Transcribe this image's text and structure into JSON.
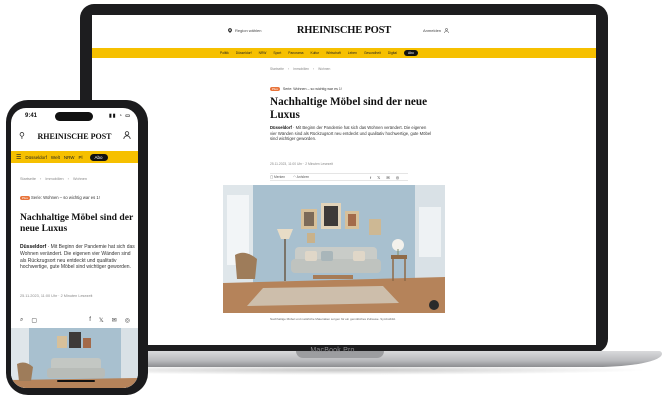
{
  "colors": {
    "brand_yellow": "#f6c000",
    "badge_orange": "#e8743b",
    "device_frame": "#1d1d1f"
  },
  "laptop": {
    "model_label": "MacBook Pro",
    "header": {
      "location_label": "Region wählen",
      "logo": "RHEINISCHE POST",
      "login_label": "Anmelden"
    },
    "nav": [
      "Politik",
      "Düsseldorf",
      "NRW",
      "Sport",
      "Panorama",
      "Kultur",
      "Wirtschaft",
      "Leben",
      "Gesundheit",
      "Digital",
      "Abo"
    ],
    "breadcrumb": [
      "Startseite",
      "Immobilien",
      "Wohnen"
    ],
    "kicker_badge": "Plus",
    "kicker": "Serie: Wohnen – so wichtig war es 1!",
    "title": "Nachhaltige Möbel sind der neue Luxus",
    "lead_city": "Düsseldorf",
    "lead_text": " · Mit Beginn der Pandemie hat sich das Wohnen verändert. Die eigenen vier Wänden sind als Rückzugsort neu entdeckt und qualitativ hochwertige, gute Möbel sind wichtiger geworden.",
    "date": "25.11.2023, 11:00 Uhr · 2 Minuten Lesezeit",
    "actions": {
      "save": "Merken",
      "listen": "Anhören"
    },
    "caption": "Nachhaltige Möbel und natürliche Materialien sorgen für ein gemütliches Zuhause. Symbolbild."
  },
  "phone": {
    "time": "9:41",
    "header": {
      "logo": "RHEINISCHE POST"
    },
    "nav": [
      "Düsseldorf",
      "Welt",
      "NRW",
      "Pl"
    ],
    "nav_abo": "Abo",
    "breadcrumb": [
      "Startseite",
      "Immobilien",
      "Wohnen"
    ],
    "kicker_badge": "Plus",
    "kicker": "Serie: Wohnen – so wichtig war es 1!",
    "title": "Nachhaltige Möbel sind der neue Luxus",
    "lead_city": "Düsseldorf",
    "lead_text": " · Mit Beginn der Pandemie hat sich das Wohnen verändert. Die eigenen vier Wänden sind als Rückzugsort neu entdeckt und qualitativ hochwertige, gute Möbel sind wichtiger geworden.",
    "date": "25.11.2023, 11:00 Uhr · 2 Minuten Lesezeit"
  },
  "icons": [
    "location-pin-icon",
    "user-icon",
    "search-icon",
    "bookmark-icon",
    "facebook-icon",
    "x-icon",
    "mail-icon",
    "whatsapp-icon",
    "headphones-icon",
    "menu-icon",
    "expand-icon"
  ]
}
